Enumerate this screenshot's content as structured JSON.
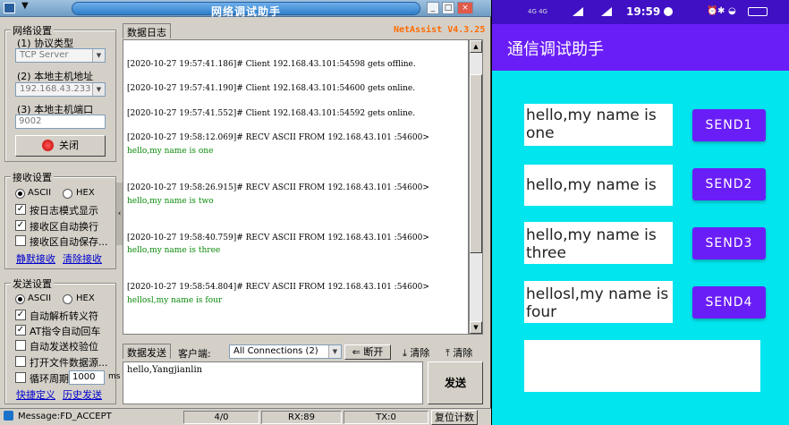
{
  "window": {
    "title": "网络调试助手",
    "brand": "NetAssist V4.3.25",
    "sys_menu_arrow": "▼"
  },
  "network": {
    "group_label": "网络设置",
    "protocol_label": "(1) 协议类型",
    "protocol_value": "TCP Server",
    "host_label": "(2) 本地主机地址",
    "host_value": "192.168.43.233",
    "port_label": "(3) 本地主机端口",
    "port_value": "9002",
    "close_label": "关闭"
  },
  "receive": {
    "group_label": "接收设置",
    "ascii_label": "ASCII",
    "hex_label": "HEX",
    "opt_log": "按日志模式显示",
    "opt_wrap": "接收区自动换行",
    "opt_save": "接收区自动保存...",
    "link_mute": "静默接收",
    "link_clear": "清除接收"
  },
  "send_settings": {
    "group_label": "发送设置",
    "ascii_label": "ASCII",
    "hex_label": "HEX",
    "opt_escape": "自动解析转义符",
    "opt_at": "AT指令自动回车",
    "opt_checksum": "自动发送校验位",
    "opt_file": "打开文件数据源...",
    "opt_cycle": "循环周期",
    "cycle_value": "1000",
    "cycle_unit": "ms",
    "link_shortcut": "快捷定义",
    "link_history": "历史发送"
  },
  "log": {
    "tab_label": "数据日志",
    "lines": [
      {
        "text": "[2020-10-27 19:57:41.186]# Client 192.168.43.101:54598 gets offline.",
        "type": "sys"
      },
      {
        "text": "[2020-10-27 19:57:41.190]# Client 192.168.43.101:54600 gets online.",
        "type": "sys"
      },
      {
        "text": "[2020-10-27 19:57:41.552]# Client 192.168.43.101:54592 gets online.",
        "type": "sys"
      },
      {
        "text": "[2020-10-27 19:58:12.069]# RECV ASCII FROM 192.168.43.101 :54600>",
        "type": "sys"
      },
      {
        "text": "hello,my name is one",
        "type": "recv"
      },
      {
        "text": "[2020-10-27 19:58:26.915]# RECV ASCII FROM 192.168.43.101 :54600>",
        "type": "sys"
      },
      {
        "text": "hello,my name is two",
        "type": "recv"
      },
      {
        "text": "[2020-10-27 19:58:40.759]# RECV ASCII FROM 192.168.43.101 :54600>",
        "type": "sys"
      },
      {
        "text": "hello,my name is three",
        "type": "recv"
      },
      {
        "text": "[2020-10-27 19:58:54.804]# RECV ASCII FROM 192.168.43.101 :54600>",
        "type": "sys"
      },
      {
        "text": "hellosl,my name is four",
        "type": "recv"
      }
    ]
  },
  "sendbar": {
    "tab_send": "数据发送",
    "client_label": "客户端:",
    "client_value": "All Connections (2)",
    "disconnect_label": "断开",
    "clear1_label": "清除",
    "clear2_label": "清除",
    "text_value": "hello,Yangjianlin",
    "send_label": "发送"
  },
  "status": {
    "message": "Message:FD_ACCEPT",
    "count": "4/0",
    "rx": "RX:89",
    "tx": "TX:0",
    "reset_label": "复位计数"
  },
  "phone": {
    "time": "19:59",
    "net_indicator": "4G 4G",
    "app_title": "通信调试助手",
    "rows": [
      {
        "text": "hello,my name is one",
        "button": "SEND1"
      },
      {
        "text": "hello,my name is two",
        "button": "SEND2"
      },
      {
        "text": "hello,my name is three",
        "button": "SEND3"
      },
      {
        "text": "hellosl,my name is four",
        "button": "SEND4"
      }
    ],
    "input_value": ""
  },
  "colors": {
    "phone_bg": "#00e5ee",
    "phone_accent": "#6a1ef7",
    "recv_text": "#0a8a0a",
    "brand": "#ff6a00"
  }
}
